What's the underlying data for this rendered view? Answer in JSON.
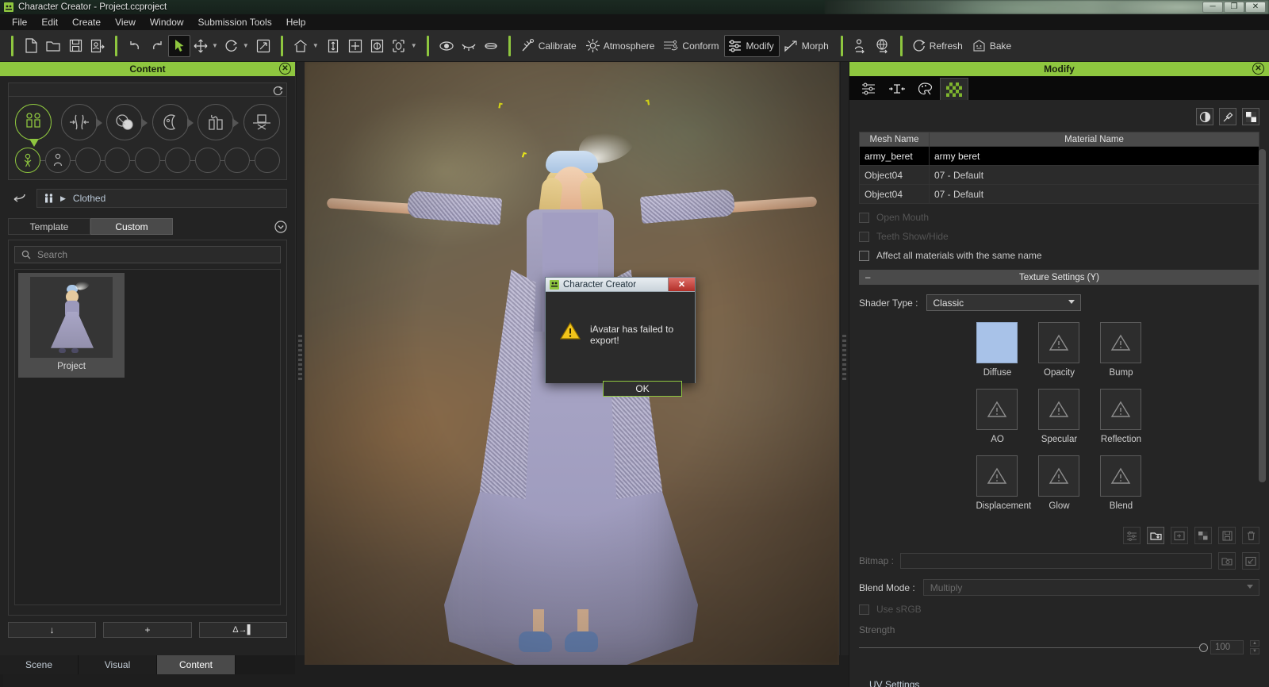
{
  "window": {
    "title": "Character Creator - Project.ccproject",
    "app_icon": "character-creator-icon",
    "minimize": "–",
    "maximize": "❐",
    "close": "✕"
  },
  "menubar": {
    "items": [
      "File",
      "Edit",
      "Create",
      "View",
      "Window",
      "Submission Tools",
      "Help"
    ]
  },
  "toolbar": {
    "groups": [
      {
        "name": "file",
        "buttons": [
          {
            "label": "",
            "icon": "new-document-icon"
          },
          {
            "label": "",
            "icon": "open-folder-icon"
          },
          {
            "label": "",
            "icon": "save-disk-icon"
          },
          {
            "label": "",
            "icon": "save-as-icon"
          }
        ]
      },
      {
        "name": "edit",
        "buttons": [
          {
            "label": "",
            "icon": "undo-icon"
          },
          {
            "label": "",
            "icon": "redo-icon"
          },
          {
            "label": "",
            "icon": "select-arrow-icon",
            "active": true
          },
          {
            "label": "",
            "icon": "move-icon",
            "dropdown": true
          },
          {
            "label": "",
            "icon": "rotate-icon",
            "dropdown": true
          },
          {
            "label": "",
            "icon": "scale-icon"
          }
        ]
      },
      {
        "name": "view",
        "buttons": [
          {
            "label": "",
            "icon": "home-view-icon",
            "dropdown": true
          },
          {
            "label": "",
            "icon": "fit-vertical-icon"
          },
          {
            "label": "",
            "icon": "fit-all-icon"
          },
          {
            "label": "",
            "icon": "frame-selected-icon"
          },
          {
            "label": "",
            "icon": "bounding-box-icon",
            "dropdown": true
          }
        ]
      },
      {
        "name": "display",
        "buttons": [
          {
            "label": "",
            "icon": "eye-icon"
          },
          {
            "label": "",
            "icon": "eyelash-icon"
          },
          {
            "label": "",
            "icon": "mouth-icon"
          }
        ]
      },
      {
        "name": "tools",
        "buttons": [
          {
            "label": "Calibrate",
            "icon": "calibrate-icon"
          },
          {
            "label": "Atmosphere",
            "icon": "atmosphere-icon"
          },
          {
            "label": "Conform",
            "icon": "conform-icon"
          },
          {
            "label": "Modify",
            "icon": "modify-icon",
            "active": true
          },
          {
            "label": "Morph",
            "icon": "morph-icon"
          }
        ]
      },
      {
        "name": "avatar",
        "buttons": [
          {
            "label": "",
            "icon": "person-export-icon"
          },
          {
            "label": "",
            "icon": "globe-export-icon"
          }
        ]
      },
      {
        "name": "render",
        "buttons": [
          {
            "label": "Refresh",
            "icon": "refresh-icon"
          },
          {
            "label": "Bake",
            "icon": "bake-icon"
          }
        ]
      }
    ]
  },
  "content_panel": {
    "title": "Content",
    "close_icon": "panel-close-icon",
    "reset_icon": "reset-icon",
    "categories_row1": [
      {
        "name": "character",
        "icon": "two-figures-icon",
        "selected": true
      },
      {
        "name": "shape",
        "icon": "shape-arrows-icon",
        "selected": false
      },
      {
        "name": "skin",
        "icon": "skin-palette-icon",
        "selected": false
      },
      {
        "name": "head",
        "icon": "head-profile-icon",
        "selected": false
      },
      {
        "name": "cloth",
        "icon": "cloth-icon",
        "selected": false
      },
      {
        "name": "accessory",
        "icon": "hat-icon",
        "selected": false
      }
    ],
    "categories_row2_selected": "character-rigged-icon",
    "categories_row2_count": 9,
    "breadcrumb": {
      "icon": "figure-pair-icon",
      "arrow": "▶",
      "label": "Clothed"
    },
    "back_icon": "back-arrow-icon",
    "tabs": [
      {
        "label": "Template",
        "selected": false
      },
      {
        "label": "Custom",
        "selected": true
      }
    ],
    "expand_icon": "chevron-down-circle-icon",
    "search": {
      "placeholder": "Search",
      "value": "",
      "icon": "search-icon"
    },
    "items": [
      {
        "label": "Project",
        "thumbnail": "avatar-thumbnail"
      }
    ],
    "footer_buttons": [
      {
        "name": "load",
        "glyph": "↓"
      },
      {
        "name": "add",
        "glyph": "+"
      },
      {
        "name": "apply-delta",
        "glyph": "Δ→▌"
      }
    ]
  },
  "dock_tabs": [
    {
      "label": "Scene",
      "selected": false
    },
    {
      "label": "Visual",
      "selected": false
    },
    {
      "label": "Content",
      "selected": true
    }
  ],
  "modify_panel": {
    "title": "Modify",
    "close_icon": "panel-close-icon",
    "tabs": [
      {
        "name": "adjust",
        "icon": "sliders-icon",
        "selected": false
      },
      {
        "name": "transform",
        "icon": "transform-icon",
        "selected": false
      },
      {
        "name": "palette",
        "icon": "palette-icon",
        "selected": false
      },
      {
        "name": "material",
        "icon": "checker-icon",
        "selected": true
      }
    ],
    "tool_icons": [
      {
        "name": "contrast",
        "icon": "half-circle-icon"
      },
      {
        "name": "eyedropper",
        "icon": "eyedropper-icon"
      },
      {
        "name": "checker",
        "icon": "checker-square-icon"
      }
    ],
    "mesh_table": {
      "headers": [
        "Mesh Name",
        "Material Name"
      ],
      "rows": [
        {
          "mesh": "army_beret",
          "material": "army beret",
          "selected": true
        },
        {
          "mesh": "Object04",
          "material": "07 - Default",
          "selected": false
        },
        {
          "mesh": "Object04",
          "material": "07 - Default",
          "selected": false
        }
      ]
    },
    "checkboxes": [
      {
        "label": "Open Mouth",
        "checked": false,
        "disabled": true
      },
      {
        "label": "Teeth Show/Hide",
        "checked": false,
        "disabled": true
      },
      {
        "label": "Affect all materials with the same name",
        "checked": false,
        "disabled": false
      }
    ],
    "texture_settings": {
      "section_title": "Texture Settings  (Y)",
      "collapse_glyph": "–",
      "shader_type_label": "Shader Type :",
      "shader_type_value": "Classic",
      "channels": [
        {
          "label": "Diffuse",
          "state": "filled",
          "color": "#a8c2e8"
        },
        {
          "label": "Opacity",
          "state": "empty"
        },
        {
          "label": "Bump",
          "state": "empty"
        },
        {
          "label": "AO",
          "state": "empty"
        },
        {
          "label": "Specular",
          "state": "empty"
        },
        {
          "label": "Reflection",
          "state": "empty"
        },
        {
          "label": "Displacement",
          "state": "empty"
        },
        {
          "label": "Glow",
          "state": "empty"
        },
        {
          "label": "Blend",
          "state": "empty"
        }
      ],
      "action_icons": [
        {
          "name": "adjust-texture",
          "icon": "sliders-small-icon"
        },
        {
          "name": "load-texture",
          "icon": "load-image-icon",
          "active": true
        },
        {
          "name": "add-texture",
          "icon": "add-image-icon"
        },
        {
          "name": "checker-texture",
          "icon": "checker-small-icon"
        },
        {
          "name": "save-texture",
          "icon": "save-small-icon"
        },
        {
          "name": "delete-texture",
          "icon": "trash-icon"
        }
      ],
      "bitmap_label": "Bitmap :",
      "bitmap_value": "",
      "bitmap_browse_icon": "browse-icon",
      "bitmap_import_icon": "import-icon",
      "blend_mode_label": "Blend Mode :",
      "blend_mode_value": "Multiply",
      "use_srgb_label": "Use sRGB",
      "use_srgb_checked": false,
      "strength_label": "Strength",
      "strength_value": "100",
      "uv_settings_label": "UV Settings"
    }
  },
  "dialog": {
    "title": "Character Creator",
    "app_icon": "character-creator-icon",
    "close_glyph": "✕",
    "warning_icon": "warning-triangle-icon",
    "message": "iAvatar has failed to export!",
    "ok_label": "OK"
  },
  "viewport": {
    "name": "3d-viewport",
    "marker_glyphs": [
      "⸢",
      "⸣",
      "⸢"
    ]
  },
  "colors": {
    "accent_green": "#8ec63f",
    "panel_bg": "#252525",
    "toolbar_bg": "#2b2b2b",
    "selected_row": "#000000",
    "diffuse_swatch": "#a8c2e8"
  }
}
